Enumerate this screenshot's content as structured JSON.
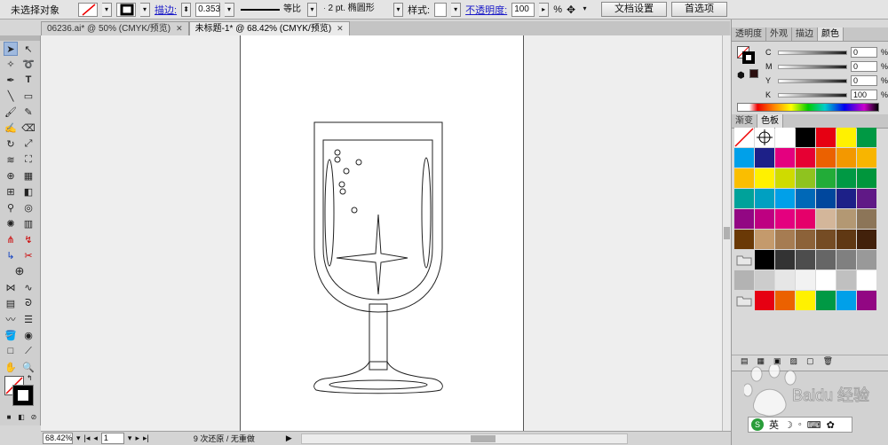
{
  "control_bar": {
    "selection_label": "未选择对象",
    "stroke_label": "描边:",
    "stroke_value": "0.353",
    "profile_label": "等比",
    "brush_label": "2 pt. 椭圆形",
    "style_label": "样式:",
    "opacity_label": "不透明度:",
    "opacity_value": "100",
    "opacity_unit": "%",
    "doc_setup_button": "文档设置",
    "prefs_button": "首选项"
  },
  "document_tabs": [
    {
      "label": "06236.ai* @ 50% (CMYK/预览)",
      "active": false
    },
    {
      "label": "未标题-1* @ 68.42% (CMYK/预览)",
      "active": true
    }
  ],
  "status_bar": {
    "zoom": "68.42%",
    "page": "1",
    "info": "9 次还原 / 无重做"
  },
  "color_panel": {
    "tabs": [
      "透明度",
      "外观",
      "描边",
      "颜色"
    ],
    "active_tab": "颜色",
    "channels": [
      {
        "name": "C",
        "value": "0"
      },
      {
        "name": "M",
        "value": "0"
      },
      {
        "name": "Y",
        "value": "0"
      },
      {
        "name": "K",
        "value": "100"
      }
    ]
  },
  "swatches_panel": {
    "tabs": [
      "渐变",
      "色板"
    ],
    "active_tab": "色板",
    "colors": [
      "none",
      "registration",
      "#ffffff",
      "#000000",
      "#e60012",
      "#fff100",
      "#009944",
      "#00a0e9",
      "#1d2088",
      "#e4007f",
      "#e60033",
      "#eb6100",
      "#f39800",
      "#f8b500",
      "#fabe00",
      "#fff100",
      "#cfdb00",
      "#8fc31f",
      "#22ac38",
      "#009944",
      "#00963c",
      "#00a29a",
      "#00a0c1",
      "#00a0e9",
      "#0068b7",
      "#00479d",
      "#1d2088",
      "#601986",
      "#920783",
      "#be0081",
      "#e4007f",
      "#e5006a",
      "#d3b69a",
      "#b39873",
      "#8c7558",
      "#6a3906",
      "#c49a6c",
      "#a67c52",
      "#8c6239",
      "#754c24",
      "#603813",
      "#42210b",
      "folder",
      "#000000",
      "#333333",
      "#4d4d4d",
      "#666666",
      "#808080",
      "#999999",
      "#b3b3b3",
      "#cccccc",
      "#e6e6e6",
      "#f2f2f2",
      "#ffffff",
      "#c0c0c0",
      "#ffffff",
      "folder",
      "#e60012",
      "#eb6100",
      "#fff100",
      "#009944",
      "#00a0e9",
      "#920783"
    ]
  },
  "watermark": {
    "text": "Baidu 经验",
    "ime": "英"
  }
}
